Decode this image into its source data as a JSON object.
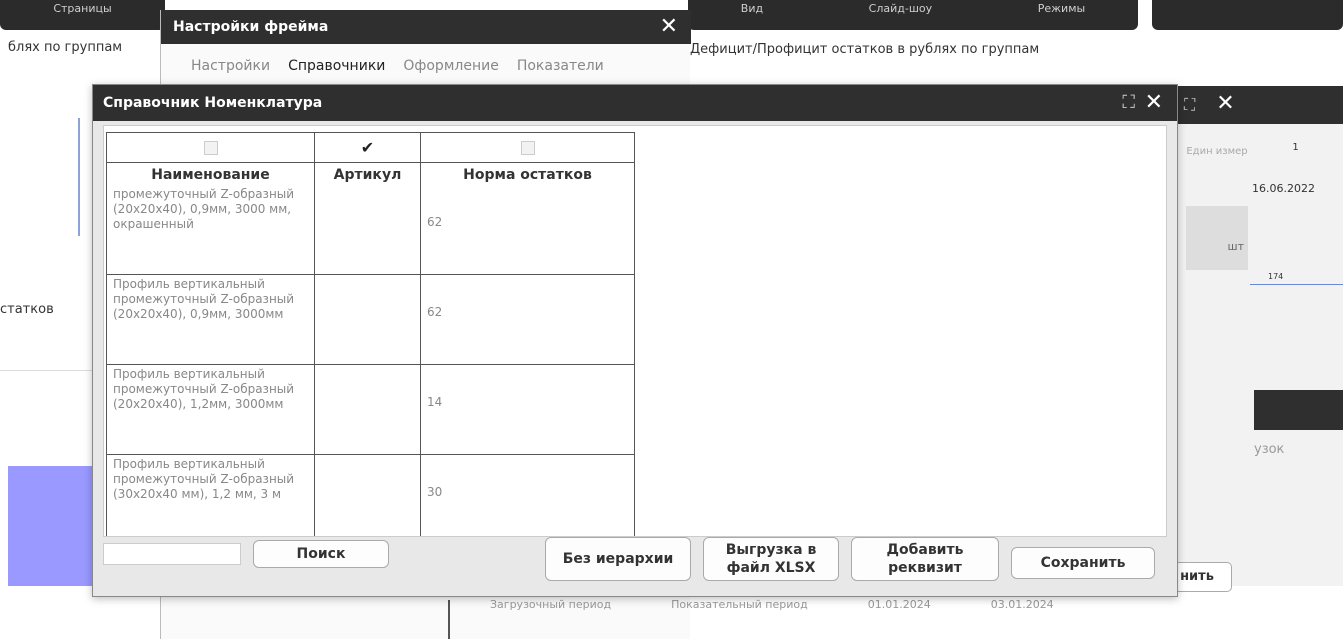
{
  "background": {
    "top_left_tab": "Страницы",
    "top_tabs": [
      "Вид",
      "Слайд-шоу",
      "Режимы"
    ],
    "left_text_1": "блях по группам",
    "left_text_2": "статков",
    "chart_title": "Дефицит/Профицит остатков в рублях по группам",
    "right_col_header": "Един измер",
    "right_unit": "шт",
    "right_date": "16.06.2022",
    "right_num_1": "1",
    "right_num_2": "174",
    "right_bottom_text": "узок",
    "right_button": "нить",
    "right_close": "✕",
    "right_expand": "⛶",
    "bottom_row_1": "Загрузочный период",
    "bottom_row_2": "Показательный период",
    "bottom_row_3": "01.01.2024",
    "bottom_row_4": "03.01.2024"
  },
  "frame_settings": {
    "title": "Настройки фрейма",
    "close": "✕",
    "tabs": [
      "Настройки",
      "Справочники",
      "Оформление",
      "Показатели"
    ],
    "active_tab": "Справочники"
  },
  "dialog": {
    "title": "Справочник Номенклатура",
    "expand": "⛶",
    "close": "✕",
    "columns": [
      "Наименование",
      "Артикул",
      "Норма остатков"
    ],
    "column_checks": [
      false,
      true,
      false
    ],
    "rows": [
      {
        "name": "промежуточный Z-образный (20х20х40), 0,9мм, 3000 мм, окрашенный",
        "article": "",
        "norm": "62"
      },
      {
        "name": "Профиль вертикальный промежуточный Z-образный (20х20х40), 0,9мм, 3000мм",
        "article": "",
        "norm": "62"
      },
      {
        "name": "Профиль вертикальный промежуточный Z-образный (20х20х40), 1,2мм, 3000мм",
        "article": "",
        "norm": "14"
      },
      {
        "name": "Профиль вертикальный промежуточный Z-образный (30х20х40 мм), 1,2 мм, 3 м",
        "article": "",
        "norm": "30"
      }
    ],
    "footer": {
      "search_value": "",
      "search_button": "Поиск",
      "no_hierarchy": "Без иерархии",
      "export_xlsx": "Выгрузка в файл XLSX",
      "add_attribute": "Добавить реквизит",
      "save": "Сохранить"
    }
  }
}
